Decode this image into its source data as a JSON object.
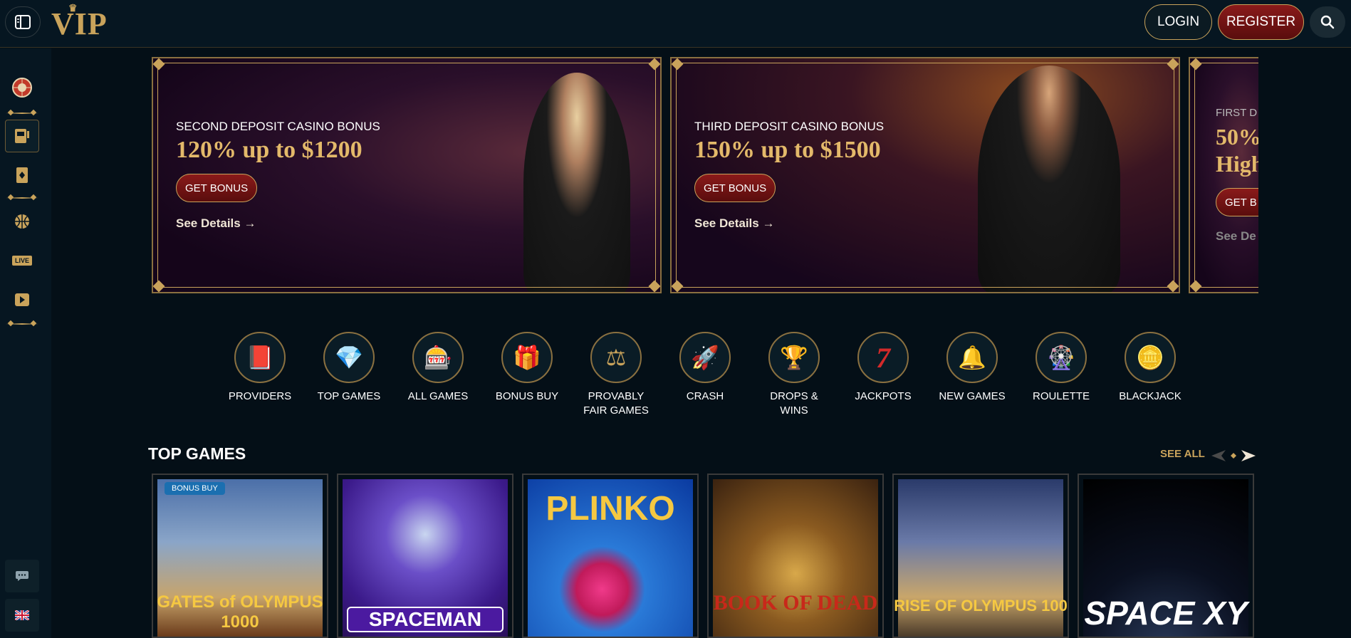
{
  "header": {
    "logo_text": "VIP",
    "login_label": "LOGIN",
    "register_label": "REGISTER",
    "brand_color": "#c9a35b",
    "accent_color": "#7a1414"
  },
  "sidebar": {
    "items": [
      {
        "icon": "roulette-wheel-icon"
      },
      {
        "icon": "slot-machine-icon",
        "active": true
      },
      {
        "icon": "card-icon"
      },
      {
        "icon": "basketball-icon"
      },
      {
        "icon": "live-icon",
        "label": "LIVE"
      },
      {
        "icon": "play-icon"
      }
    ],
    "bottom": [
      {
        "icon": "chat-icon"
      },
      {
        "icon": "uk-flag-icon"
      }
    ]
  },
  "banners": [
    {
      "subtitle": "SECOND DEPOSIT CASINO BONUS",
      "title": "120% up to $1200",
      "cta": "GET BONUS",
      "details": "See Details →"
    },
    {
      "subtitle": "THIRD DEPOSIT CASINO BONUS",
      "title": "150% up to $1500",
      "cta": "GET BONUS",
      "details": "See Details →"
    },
    {
      "subtitle": "FIRST D",
      "title": "50%",
      "title2": "High",
      "cta": "GET B",
      "details": "See De"
    }
  ],
  "categories": [
    {
      "label": "PROVIDERS",
      "icon": "📕"
    },
    {
      "label": "TOP GAMES",
      "icon": "💎"
    },
    {
      "label": "ALL GAMES",
      "icon": "🎰"
    },
    {
      "label": "BONUS BUY",
      "icon": "🎁"
    },
    {
      "label": "PROVABLY FAIR GAMES",
      "icon": "⚖"
    },
    {
      "label": "CRASH",
      "icon": "🚀"
    },
    {
      "label": "DROPS & WINS",
      "icon": "🏆"
    },
    {
      "label": "JACKPOTS",
      "icon": "7"
    },
    {
      "label": "NEW GAMES",
      "icon": "🔔"
    },
    {
      "label": "ROULETTE",
      "icon": "🎡"
    },
    {
      "label": "BLACKJACK",
      "icon": "🪙"
    }
  ],
  "top_games": {
    "title": "TOP GAMES",
    "see_all": "SEE ALL",
    "games": [
      {
        "name": "GATES of OLYMPUS 1000",
        "badge": "BONUS BUY"
      },
      {
        "name": "SPACEMAN"
      },
      {
        "name": "PLINKO"
      },
      {
        "name": "BOOK OF DEAD"
      },
      {
        "name": "RISE OF OLYMPUS 100"
      },
      {
        "name": "SPACE XY"
      }
    ]
  }
}
